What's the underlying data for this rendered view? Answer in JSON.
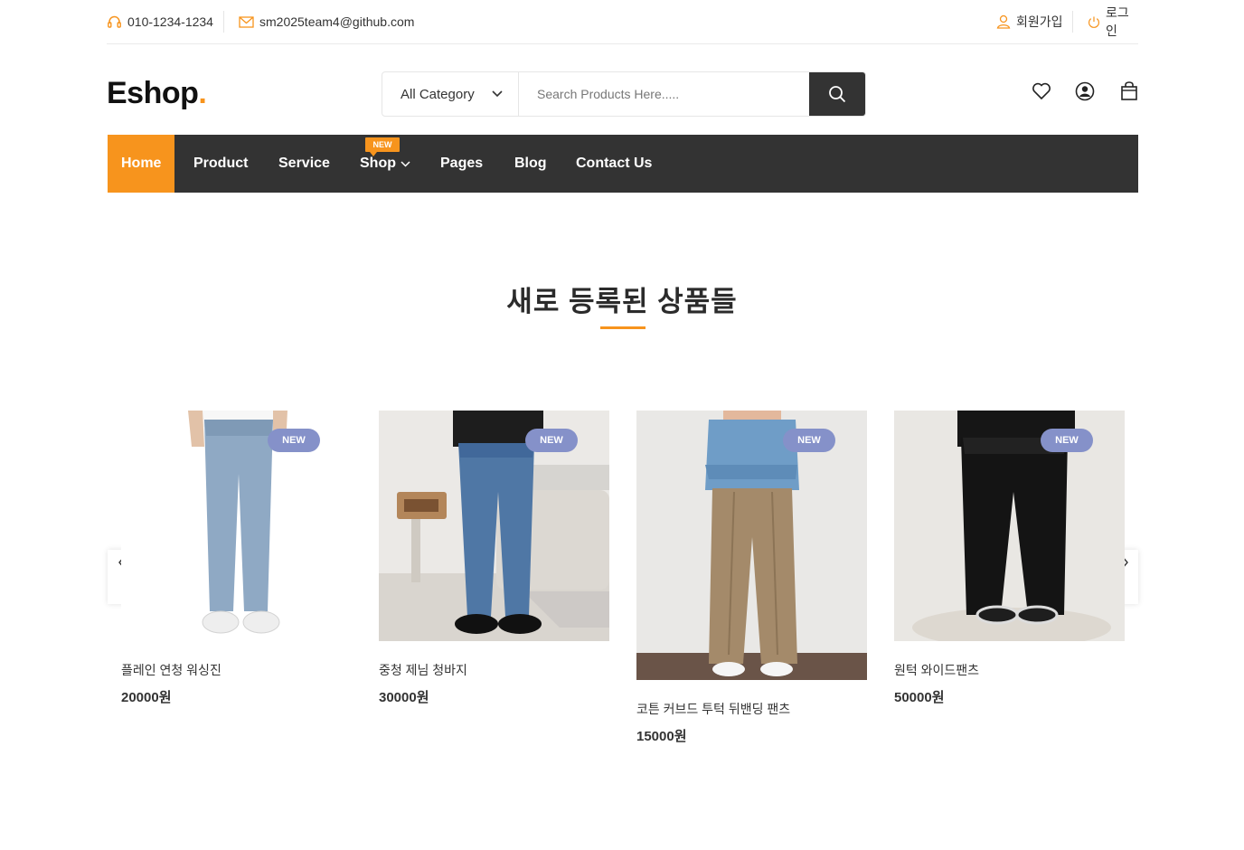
{
  "topbar": {
    "phone": "010-1234-1234",
    "email": "sm2025team4@github.com",
    "signup": "회원가입",
    "login": "로그인"
  },
  "header": {
    "logo": "Eshop",
    "logo_dot": ".",
    "category_label": "All Category",
    "search_placeholder": "Search Products Here....."
  },
  "nav": {
    "items": [
      "Home",
      "Product",
      "Service",
      "Shop",
      "Pages",
      "Blog",
      "Contact Us"
    ],
    "active": "Home",
    "shop_badge": "NEW"
  },
  "section": {
    "title": "새로 등록된 상품들"
  },
  "products": [
    {
      "name": "플레인 연청 워싱진",
      "price": "20000원",
      "badge": "NEW"
    },
    {
      "name": "중청 제님 청바지",
      "price": "30000원",
      "badge": "NEW"
    },
    {
      "name": "코튼 커브드 투턱 뒤밴딩 팬츠",
      "price": "15000원",
      "badge": "NEW"
    },
    {
      "name": "원턱 와이드팬츠",
      "price": "50000원",
      "badge": "NEW"
    }
  ],
  "colors": {
    "accent": "#f7941d",
    "nav_bg": "#333333",
    "badge": "#8591c9"
  }
}
